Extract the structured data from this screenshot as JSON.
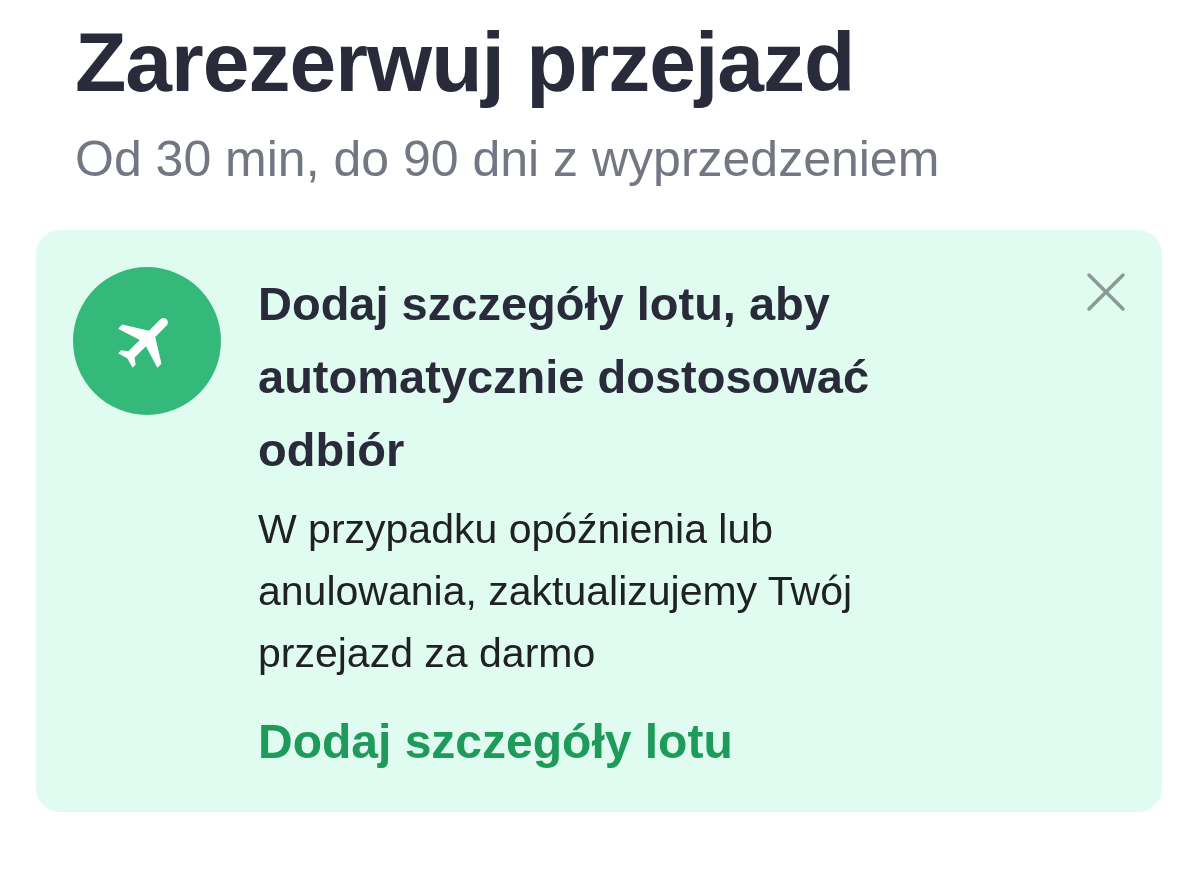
{
  "title": "Zarezerwuj przejazd",
  "subtitle": "Od 30 min, do 90 dni z wyprzedzeniem",
  "banner": {
    "heading": "Dodaj szczegóły lotu, aby automatycznie dostosować odbiór",
    "body": "W przypadku opóźnienia lub anulowania, zaktualizujemy Twój przejazd za darmo",
    "link": "Dodaj szczegóły lotu",
    "dismissible": true
  }
}
